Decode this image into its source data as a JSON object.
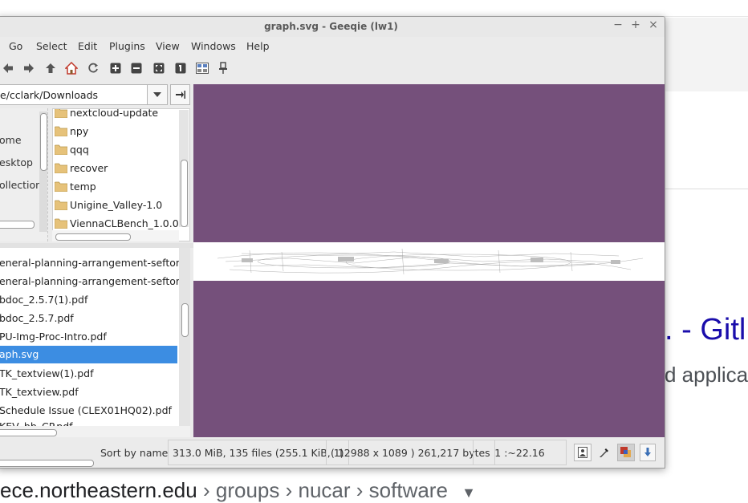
{
  "window": {
    "title": "graph.svg - Geeqie (lw1)"
  },
  "menu": [
    "Go",
    "Select",
    "Edit",
    "Plugins",
    "View",
    "Windows",
    "Help"
  ],
  "toolbar": [
    "back-icon",
    "forward-icon",
    "up-icon",
    "home-icon",
    "refresh-icon",
    "zoom-in-icon",
    "zoom-out-icon",
    "zoom-fit-icon",
    "zoom-1to1-icon",
    "thumbnails-icon",
    "pin-icon"
  ],
  "path": {
    "value": "e/cclark/Downloads"
  },
  "bookmarks": [
    "ome",
    "esktop",
    "ollections"
  ],
  "folders": [
    "nextcloud-update",
    "npy",
    "qqq",
    "recover",
    "temp",
    "Unigine_Valley-1.0",
    "ViennaCLBench_1.0.0"
  ],
  "files": [
    "eneral-planning-arrangement-sefton-to-c",
    "eneral-planning-arrangement-sefton-to-c",
    "bdoc_2.5.7(1).pdf",
    "bdoc_2.5.7.pdf",
    "PU-Img-Proc-Intro.pdf",
    "aph.svg",
    "TK_textview(1).pdf",
    "TK_textview.pdf",
    "Schedule Issue (CLEX01HQ02).pdf",
    "KEV_bb_CP.pdf"
  ],
  "selected_file": "aph.svg",
  "status": {
    "sort": "Sort by name",
    "totals": "313.0 MiB, 135 files (255.1 KiB, 1)",
    "image_info": "( 12988 x 1089 ) 261,217 bytes",
    "zoom": "1 :~22.16"
  },
  "background_page": {
    "title_fragment": ". - Gitl",
    "snippet_fragment": "d applica",
    "url_domain": "ece.northeastern.edu",
    "url_crumbs": [
      "groups",
      "nucar",
      "software"
    ]
  },
  "colors": {
    "viewer_bg": "#75507b",
    "selection": "#3c8de2",
    "link": "#1a0dab"
  }
}
